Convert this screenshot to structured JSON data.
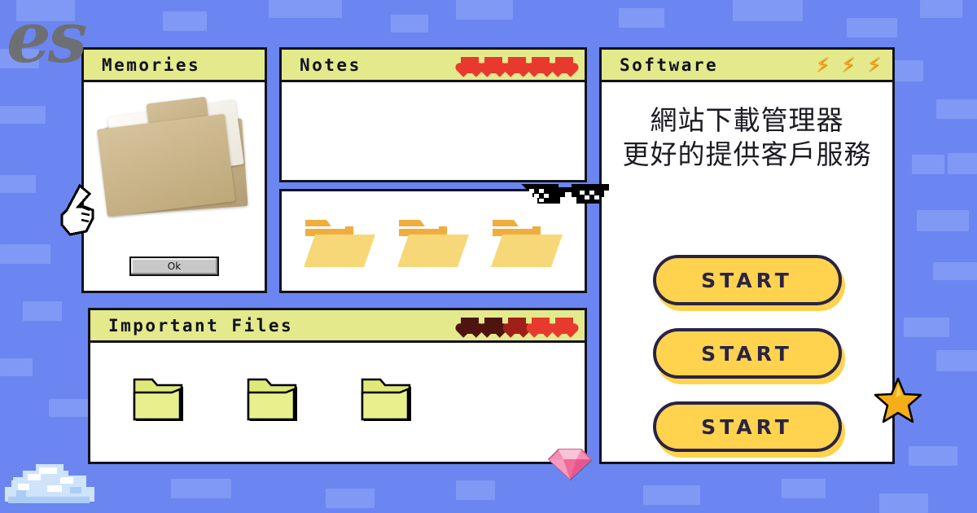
{
  "theme": {
    "background_blue": "#6b86f0",
    "brick_blue": "#8099f5",
    "title_bar_yellow": "#e4e98c",
    "outline_dark": "#11121e",
    "button_yellow": "#ffd34e",
    "button_border_navy": "#2a2344",
    "heart_red": "#e8392f",
    "heart_dark": "#4d1410",
    "bolt_orange": "#f5a623"
  },
  "logo": {
    "text": "es"
  },
  "windows": {
    "memories": {
      "title": "Memories",
      "ok_button_label": "Ok",
      "image_alt": "manila-file-folders-photo"
    },
    "notes": {
      "title": "Notes",
      "hearts": [
        "#e8392f",
        "#e8392f",
        "#e8392f",
        "#e8392f",
        "#e8392f"
      ],
      "body_text": ""
    },
    "notes_files": {
      "folders": [
        "folder-open-icon",
        "folder-open-icon",
        "folder-open-icon"
      ]
    },
    "important_files": {
      "title": "Important Files",
      "hearts": [
        "#4d1410",
        "#4d1410",
        "#9e2018",
        "#e8392f",
        "#e8392f"
      ],
      "folders": [
        "folder-pixel-icon",
        "folder-pixel-icon",
        "folder-pixel-icon"
      ]
    },
    "software": {
      "title": "Software",
      "bolts": [
        "⚡",
        "⚡",
        "⚡"
      ],
      "headline_line1": "網站下載管理器",
      "headline_line2": "更好的提供客戶服務",
      "buttons": [
        {
          "label": "START"
        },
        {
          "label": "START"
        },
        {
          "label": "START"
        }
      ]
    }
  },
  "stickers": {
    "cursor": "pointing-hand-cursor-icon",
    "sunglasses": "pixel-sunglasses-icon",
    "gem": "pink-diamond-icon",
    "star": "gold-star-icon",
    "cloud": "pixel-cloud-icon"
  }
}
